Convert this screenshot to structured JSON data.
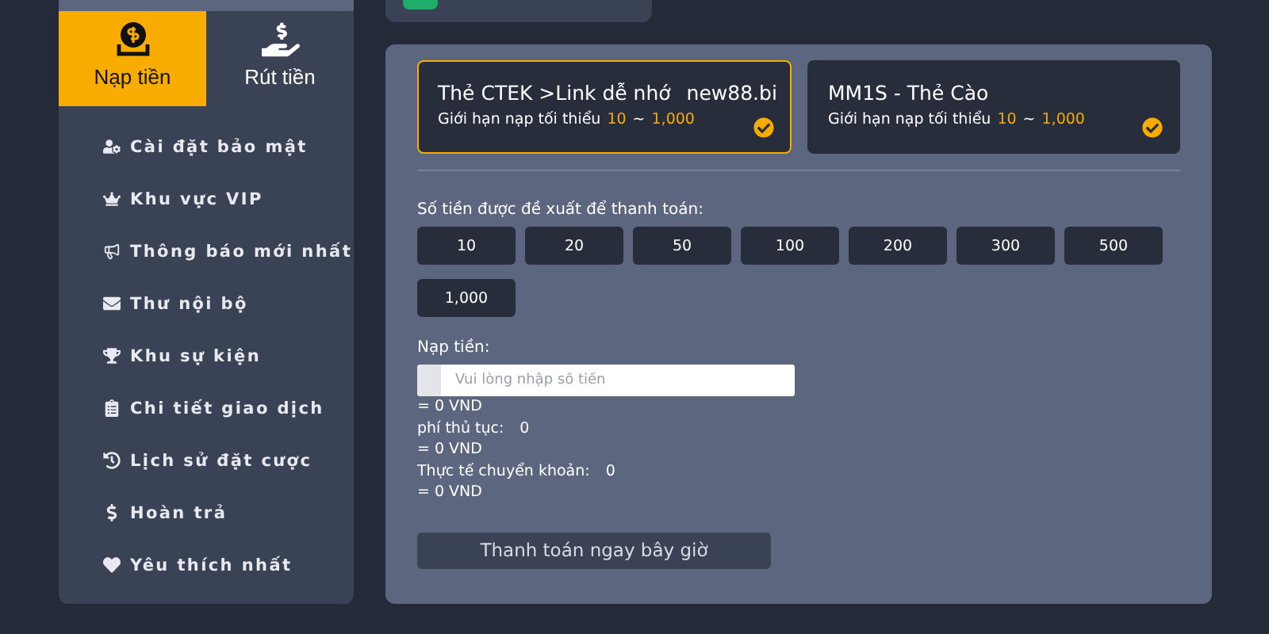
{
  "tabs": [
    {
      "label": "Nạp tiền",
      "kind": "deposit",
      "selected": true
    },
    {
      "label": "Rút tiền",
      "kind": "withdraw",
      "selected": false
    }
  ],
  "menu": [
    {
      "label": "Cài đặt bảo mật",
      "kind": "security"
    },
    {
      "label": "Khu vực VIP",
      "kind": "vip"
    },
    {
      "label": "Thông báo mới nhất",
      "kind": "news"
    },
    {
      "label": "Thư nội bộ",
      "kind": "mail"
    },
    {
      "label": "Khu sự kiện",
      "kind": "events"
    },
    {
      "label": "Chi tiết giao dịch",
      "kind": "transactions"
    },
    {
      "label": "Lịch sử đặt cược",
      "kind": "history"
    },
    {
      "label": "Hoàn trả",
      "kind": "rebate"
    },
    {
      "label": "Yêu thích nhất",
      "kind": "favorites"
    }
  ],
  "methods": [
    {
      "title": "Thẻ CTEK >Link dễ nhớ",
      "suffix": "new88.bi",
      "limit_label": "Giới hạn nạp tối thiểu",
      "limit_min": "10",
      "limit_sep": "~",
      "limit_max": "1,000",
      "selected": true
    },
    {
      "title": "MM1S - Thẻ Cào",
      "limit_label": "Giới hạn nạp tối thiểu",
      "limit_min": "10",
      "limit_sep": "~",
      "limit_max": "1,000",
      "selected": false
    }
  ],
  "suggest_label": "Số tiền được đề xuất để thanh toán:",
  "amounts": [
    "10",
    "20",
    "50",
    "100",
    "200",
    "300",
    "500",
    "1,000"
  ],
  "amount_label": "Nạp tiền:",
  "amount_field": {
    "placeholder": "Vui lòng nhập số tiền"
  },
  "lines": [
    {
      "kind": "value",
      "text": "= 0 VND"
    },
    {
      "kind": "pair",
      "label": "phí thủ tục:",
      "value": "0"
    },
    {
      "kind": "value",
      "text": "= 0 VND"
    },
    {
      "kind": "pair",
      "label": "Thực tế chuyển khoản:",
      "value": "0"
    },
    {
      "kind": "value",
      "text": "= 0 VND"
    }
  ],
  "submit": "Thanh toán ngay bây giờ"
}
